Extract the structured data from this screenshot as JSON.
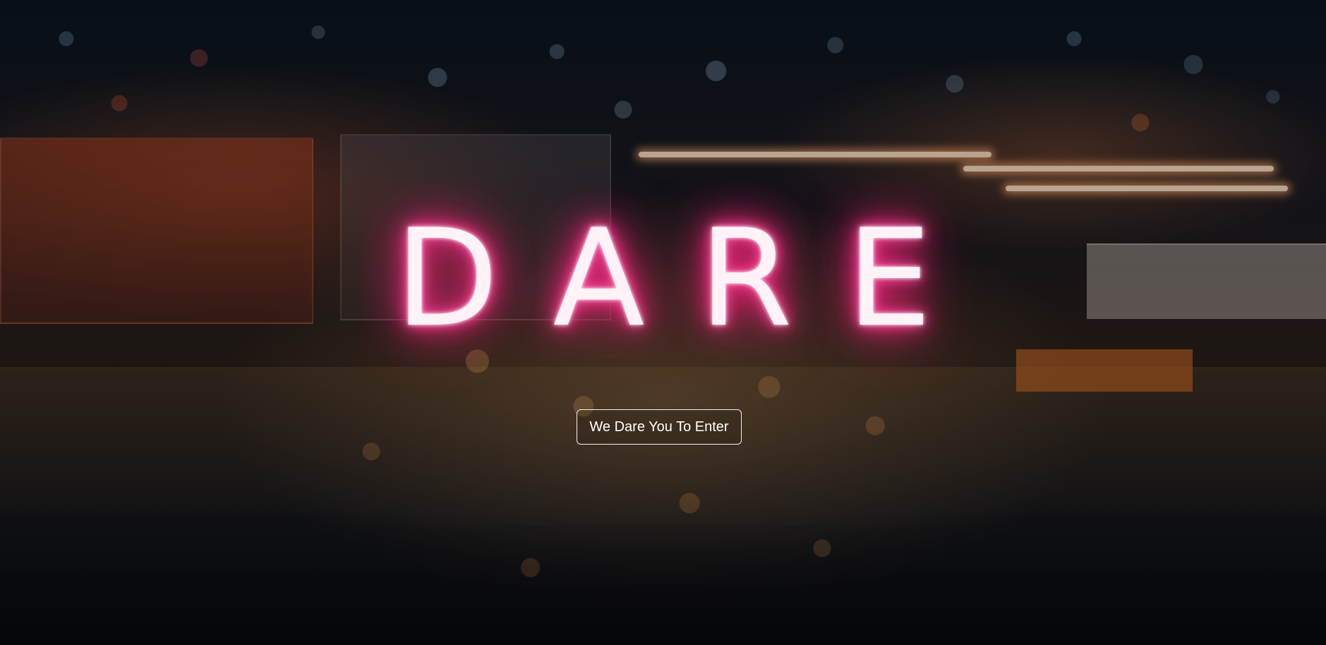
{
  "hero": {
    "title_letters": [
      "D",
      "A",
      "R",
      "E"
    ],
    "cta_label": "We Dare You To Enter",
    "neon_color": "#ff2e8a",
    "background_image": "night-food-court-bokeh"
  }
}
